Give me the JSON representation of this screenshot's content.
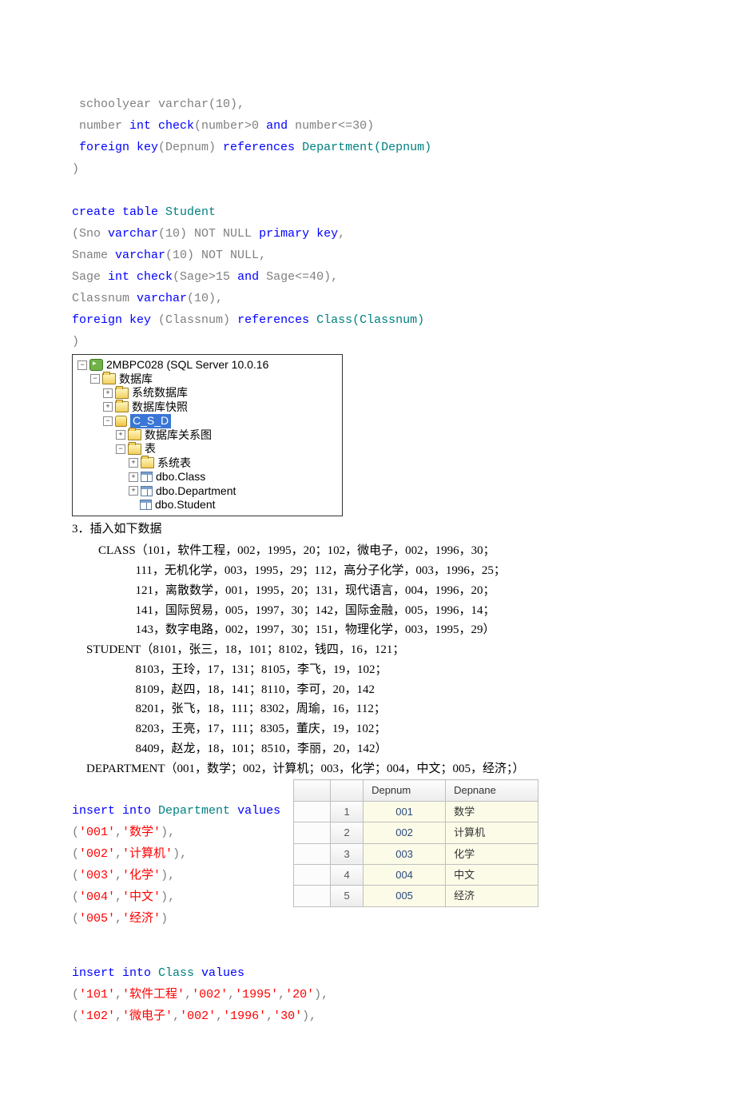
{
  "sql": {
    "class_tail": {
      "l1": " schoolyear varchar(10),",
      "l2_a": " number ",
      "l2_b": "int",
      "l2_c": " check",
      "l2_d": "(number>0 ",
      "l2_e": "and",
      "l2_f": " number<=30)",
      "l3_a": " foreign",
      "l3_b": " key",
      "l3_c": "(Depnum) ",
      "l3_d": "references",
      "l3_e": " Department(Depnum)",
      "l4": ")"
    },
    "student": {
      "l1_a": "create",
      "l1_b": " table",
      "l1_c": " Student",
      "l2_a": "(Sno ",
      "l2_b": "varchar",
      "l2_c": "(10) ",
      "l2_d": "NOT NULL",
      "l2_e": " primary",
      "l2_f": " key",
      "l2_g": ",",
      "l3_a": "Sname ",
      "l3_b": "varchar",
      "l3_c": "(10) ",
      "l3_d": "NOT NULL",
      "l3_e": ",",
      "l4_a": "Sage ",
      "l4_b": "int",
      "l4_c": " check",
      "l4_d": "(Sage>15 ",
      "l4_e": "and",
      "l4_f": " Sage<=40),",
      "l5_a": "Classnum ",
      "l5_b": "varchar",
      "l5_c": "(10),",
      "l6_a": "foreign",
      "l6_b": " key",
      "l6_c": " (Classnum) ",
      "l6_d": "references",
      "l6_e": " Class(Classnum)",
      "l7": ")"
    },
    "ins_dep": {
      "l1_a": "insert",
      "l1_b": " into",
      "l1_c": " Department ",
      "l1_d": "values",
      "r1_a": "(",
      "r1_b": "'001'",
      "r1_c": ",",
      "r1_d": "'数学'",
      "r1_e": "),",
      "r2_a": "(",
      "r2_b": "'002'",
      "r2_c": ",",
      "r2_d": "'计算机'",
      "r2_e": "),",
      "r3_a": "(",
      "r3_b": "'003'",
      "r3_c": ",",
      "r3_d": "'化学'",
      "r3_e": "),",
      "r4_a": "(",
      "r4_b": "'004'",
      "r4_c": ",",
      "r4_d": "'中文'",
      "r4_e": "),",
      "r5_a": "(",
      "r5_b": "'005'",
      "r5_c": ",",
      "r5_d": "'经济'",
      "r5_e": ")"
    },
    "ins_class": {
      "l1_a": "insert",
      "l1_b": " into",
      "l1_c": " Class ",
      "l1_d": "values",
      "r1_a": "(",
      "r1_b": "'101'",
      "r1_c": ",",
      "r1_d": "'软件工程'",
      "r1_e": ",",
      "r1_f": "'002'",
      "r1_g": ",",
      "r1_h": "'1995'",
      "r1_i": ",",
      "r1_j": "'20'",
      "r1_k": "),",
      "r2_a": "(",
      "r2_b": "'102'",
      "r2_c": ",",
      "r2_d": "'微电子'",
      "r2_e": ",",
      "r2_f": "'002'",
      "r2_g": ",",
      "r2_h": "'1996'",
      "r2_i": ",",
      "r2_j": "'30'",
      "r2_k": "),"
    }
  },
  "tree": {
    "root": "2MBPC028 (SQL Server 10.0.16",
    "db_root": "数据库",
    "sysdb": "系统数据库",
    "snap": "数据库快照",
    "csdb": "C_S_D",
    "diag": "数据库关系图",
    "tables": "表",
    "systbl": "系统表",
    "t1": "dbo.Class",
    "t2": "dbo.Department",
    "t3": "dbo.Student"
  },
  "text": {
    "sec3": "3．插入如下数据",
    "class_h": "CLASS（101，软件工程，002，1995，20；102，微电子，002，1996，30；",
    "class_l2": "111，无机化学，003，1995，29；112，高分子化学，003，1996，25；",
    "class_l3": "121，离散数学，001，1995，20；131，现代语言，004，1996，20；",
    "class_l4": "141，国际贸易，005，1997，30；142，国际金融，005，1996，14；",
    "class_l5": "143，数字电路，002，1997，30；151，物理化学，003，1995，29）",
    "stu_h": "STUDENT（8101，张三，18，101；8102，钱四，16，121；",
    "stu_l2": "8103，王玲，17，131；8105，李飞，19，102；",
    "stu_l3": "8109，赵四，18，141；8110，李可，20，142",
    "stu_l4": "8201，张飞，18，111；8302，周瑜，16，112；",
    "stu_l5": "8203，王亮，17，111；8305，董庆，19，102；",
    "stu_l6": "8409，赵龙，18，101；8510，李丽，20，142）",
    "dep_h": "DEPARTMENT（001，数学；002，计算机；003，化学；004，中文；005，经济；）"
  },
  "dep_table": {
    "h1": "Depnum",
    "h2": "Depnane",
    "rows": [
      {
        "n": "1",
        "num": "001",
        "name": "数学"
      },
      {
        "n": "2",
        "num": "002",
        "name": "计算机"
      },
      {
        "n": "3",
        "num": "003",
        "name": "化学"
      },
      {
        "n": "4",
        "num": "004",
        "name": "中文"
      },
      {
        "n": "5",
        "num": "005",
        "name": "经济"
      }
    ]
  }
}
